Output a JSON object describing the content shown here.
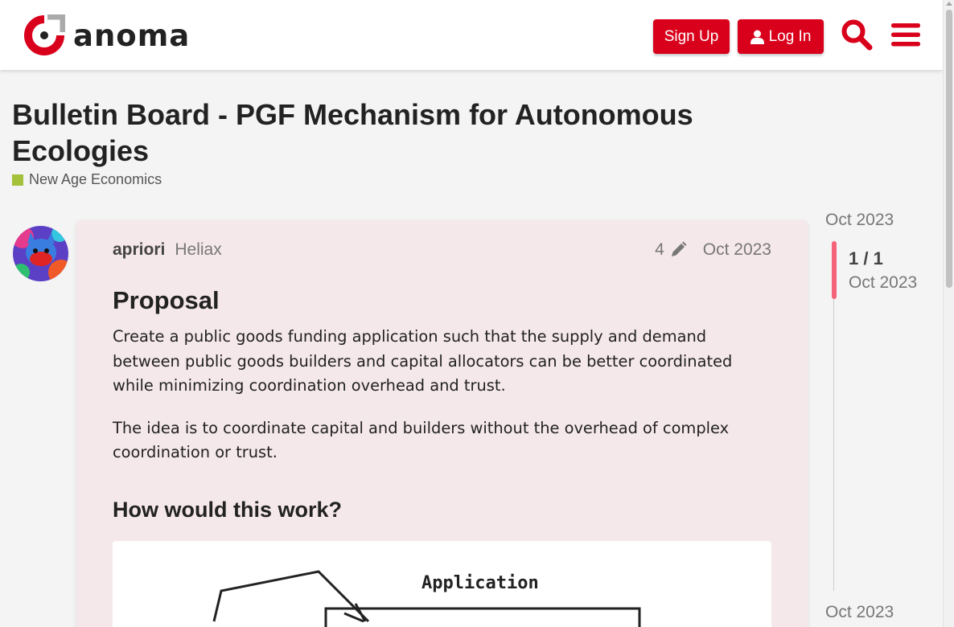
{
  "header": {
    "logo_text": "anoma",
    "signup_label": "Sign Up",
    "login_label": "Log In",
    "accent_color": "#d9001b"
  },
  "topic": {
    "title": "Bulletin Board - PGF Mechanism for Autonomous Ecologies",
    "category": "New Age Economics",
    "category_color": "#a3c13a"
  },
  "post": {
    "username": "apriori",
    "user_title": "Heliax",
    "edit_count": "4",
    "date": "Oct 2023",
    "heading": "Proposal",
    "paragraphs": [
      "Create a public goods funding application such that the supply and demand between public goods builders and capital allocators can be better coordinated while minimizing coordination overhead and trust.",
      "The idea is to coordinate capital and builders without the overhead of complex coordination or trust."
    ],
    "subheading": "How would this work?",
    "diagram_label": "Application"
  },
  "timeline": {
    "start_date": "Oct 2023",
    "position": "1 / 1",
    "handle_date": "Oct 2023",
    "end_date": "Oct 2023"
  },
  "icons": {
    "logo": "anoma-logo-icon",
    "login": "user-icon",
    "search": "search-icon",
    "menu": "hamburger-menu-icon",
    "edit": "pencil-icon"
  }
}
